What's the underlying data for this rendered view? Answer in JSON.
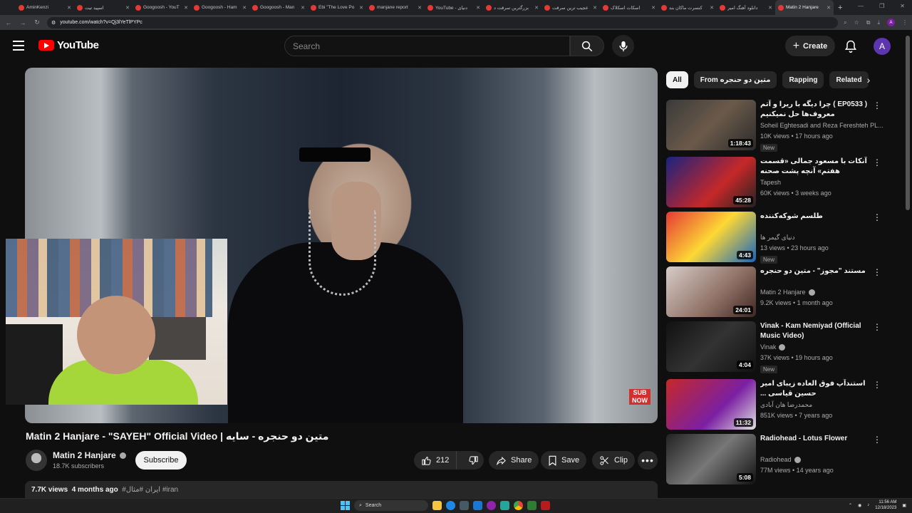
{
  "browser": {
    "tabs": [
      {
        "title": "AminKenzi",
        "active": false
      },
      {
        "title": "اسپید تیت",
        "active": false
      },
      {
        "title": "Googoosh - YouT",
        "active": false
      },
      {
        "title": "Googoosh - Ham",
        "active": false
      },
      {
        "title": "Googoosh - Man",
        "active": false
      },
      {
        "title": "Ebi \"The Love Po",
        "active": false
      },
      {
        "title": "manjane report",
        "active": false
      },
      {
        "title": "YouTube - دنیای",
        "active": false
      },
      {
        "title": "بزرگترین سرقت د",
        "active": false
      },
      {
        "title": "عجیب ترین سرقت",
        "active": false
      },
      {
        "title": "اسکات اسکلاک",
        "active": false
      },
      {
        "title": "کنسرت ماکان بند",
        "active": false
      },
      {
        "title": "دانلود آهنگ امیر",
        "active": false
      },
      {
        "title": "Matin 2 Hanjare",
        "active": true
      }
    ],
    "url": "youtube.com/watch?v=Qj3lYeTlPYPc",
    "profile_initial": "A"
  },
  "header": {
    "logo_text": "YouTube",
    "search_placeholder": "Search",
    "create_label": "Create",
    "avatar_initial": "A"
  },
  "video": {
    "title": "Matin 2 Hanjare - \"SAYEH\" Official Video | متین دو حنجره - سایه",
    "channel": "Matin 2 Hanjare",
    "subscribers": "18.7K subscribers",
    "subscribe_label": "Subscribe",
    "likes": "212",
    "share_label": "Share",
    "save_label": "Save",
    "clip_label": "Clip",
    "views": "7.7K views",
    "age": "4 months ago",
    "tags": "#ایران #مثال #iran",
    "corner_logo_top": "SUB",
    "corner_logo_bottom": "NOW"
  },
  "chips": [
    "All",
    "From متین دو حنجره",
    "Rapping",
    "Related"
  ],
  "recommendations": [
    {
      "title": "چرا دیگه با ریرا و آتم ( EP0533 ) معروف‌ها حل نمیکنیم",
      "channel": "Soheil Eghtesadi and Reza Fereshteh PL...",
      "verified": false,
      "meta": "10K views • 17 hours ago",
      "badge": "New",
      "duration": "1:18:43"
    },
    {
      "title": "آنکات با مسعود جمالی «قسمت هفتم» آنچه پشت صحنه کنسرت‌ها گذشت وحرف‌هایی ...",
      "channel": "Tapesh",
      "verified": false,
      "meta": "60K views • 3 weeks ago",
      "badge": "",
      "duration": "45:28"
    },
    {
      "title": "طلسم شوکه‌کننده",
      "channel": "دنیای گیمر ها",
      "verified": false,
      "meta": "13 views • 23 hours ago",
      "badge": "New",
      "duration": "4:43"
    },
    {
      "title": "مستند \"مجوز\" - متین دو حنجره",
      "channel": "Matin 2 Hanjare",
      "verified": true,
      "meta": "9.2K views • 1 month ago",
      "badge": "",
      "duration": "24:01"
    },
    {
      "title": "Vinak - Kam Nemiyad (Official Music Video)",
      "channel": "Vinak",
      "verified": true,
      "meta": "37K views • 19 hours ago",
      "badge": "New",
      "duration": "4:04"
    },
    {
      "title": "استندآپ فوق العاده زیبای امیر حسین قیاسی ... عاااااااااشقششششششششش دیبیی زرر",
      "channel": "محمدرضا هان آبادی",
      "verified": false,
      "meta": "851K views • 7 years ago",
      "badge": "",
      "duration": "11:32"
    },
    {
      "title": "Radiohead - Lotus Flower",
      "channel": "Radiohead",
      "verified": true,
      "meta": "77M views • 14 years ago",
      "badge": "",
      "duration": "5:08"
    }
  ],
  "taskbar": {
    "search_label": "Search",
    "time": "11:56 AM",
    "date": "12/18/2023"
  }
}
